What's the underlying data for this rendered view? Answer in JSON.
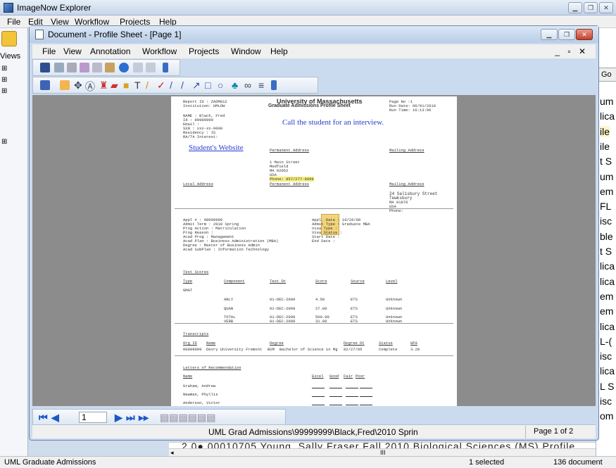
{
  "app": {
    "title": "ImageNow Explorer",
    "menu": [
      "File",
      "Edit",
      "View",
      "Workflow",
      "Projects",
      "Help"
    ],
    "views_label": "Views"
  },
  "doc": {
    "title": "Document - Profile Sheet - [Page 1]",
    "menu": [
      "File",
      "View",
      "Annotation",
      "Workflow",
      "Projects",
      "Window",
      "Help"
    ],
    "report": {
      "id": "Report ID  : ZADM012",
      "institution": "Institution: UMLOW",
      "univ": "University of Massachusetts",
      "sheet": "Graduate Admissions Profile Sheet",
      "page_no": "Page No :1",
      "run_date": "Run Date: 06/01/2010",
      "run_time": "Run Time: 16:13:06",
      "bio": [
        "NAME          :  Black, Fred",
        "Id            :  99999999",
        "Email         :",
        "SSN           :  xxx-xx-0000",
        "Residency     :  IS",
        "RA/TA Interest:"
      ],
      "annotation_call": "Call the student for an interview.",
      "annotation_link": "Student's Website",
      "perm_addr_h": "Permanent Address",
      "mail_addr_h": "Mailing Address",
      "local_addr_h": "Local Address",
      "perm_addr": [
        "1 Main Street",
        "Medfield",
        "MA 02052",
        "USA"
      ],
      "phone": "Phone:   857/277-9999",
      "mail_addr": [
        "24 Salisbury Street",
        "Tewksbury",
        "MA 01876",
        "USA",
        "Phone:"
      ],
      "appl_left": [
        "Appl #        :  99999999",
        "Admit Term    :  2010 Spring",
        "Prog Action   :  Matriculation",
        "Prog Reason   :",
        "Acad Prog     :  Management",
        "Acad Plan     :  Business Administration (MBA)",
        "Degree        :  Master of Business Admin",
        "Acad SubPlan  :  Information Technology"
      ],
      "appl_right": [
        "Appl. Date   :  10/26/09",
        "Admit Type   :  Graduate MBA",
        "Visa Type    :",
        "Visa Status  :",
        "Start Date   :",
        "End Date     :"
      ],
      "test_h": "Test Scores",
      "test_cols": [
        "Type",
        "Component",
        "Test Dt",
        "Score",
        "Source",
        "Level"
      ],
      "test_type": "GMAT",
      "test_rows": [
        [
          "ANLY",
          "01-DEC-2009",
          "4.50",
          "ETS",
          "Unknown"
        ],
        [
          "QUAN",
          "01-DEC-2009",
          "27.00",
          "ETS",
          "Unknown"
        ],
        [
          "TOTAL",
          "01-DEC-2009",
          "500.00",
          "ETS",
          "Unknown"
        ],
        [
          "VERB",
          "01-DEC-2009",
          "31.00",
          "ETS",
          "Unknown"
        ]
      ],
      "trans_h": "Transcripts",
      "trans_cols": [
        "Org ID",
        "Name",
        "Degree",
        "Degree Dt",
        "Status",
        "GPA"
      ],
      "trans_row": [
        "00009999",
        "Devry University Fremont",
        "BSM",
        "Bachelor of Science in Mg",
        "02/27/05",
        "Complete",
        "3.29"
      ],
      "letters_h": "Letters of Recommendation",
      "letters_cols": [
        "Name",
        "Excel",
        "Good",
        "Fair",
        "Poor"
      ],
      "letters": [
        "Graham, Andrew",
        "Newman, Phyllis",
        "Anderson, Victor"
      ]
    },
    "page_input": "1",
    "path": "UML Grad Admissions\\99999999\\Black,Fred\\2010 Sprin",
    "page_of": "Page 1 of 2"
  },
  "right_list": {
    "go": "Go",
    "items": [
      "um",
      "lica",
      "ile",
      "ile",
      "t S",
      "um",
      "em",
      "FL",
      "isc",
      "ble",
      "t S",
      "lica",
      "lica",
      "em",
      "em",
      "lica",
      "L-(",
      "isc",
      "lica",
      "L S",
      "isc",
      "om"
    ]
  },
  "bg_row": "2.0●  00010705  Young, Sally Fraser  Fall 2010  Biological Sciences  (MS)  Profile",
  "status": {
    "left": "UML Graduate Admissions",
    "mid": "1 selected",
    "right": "136 document"
  }
}
